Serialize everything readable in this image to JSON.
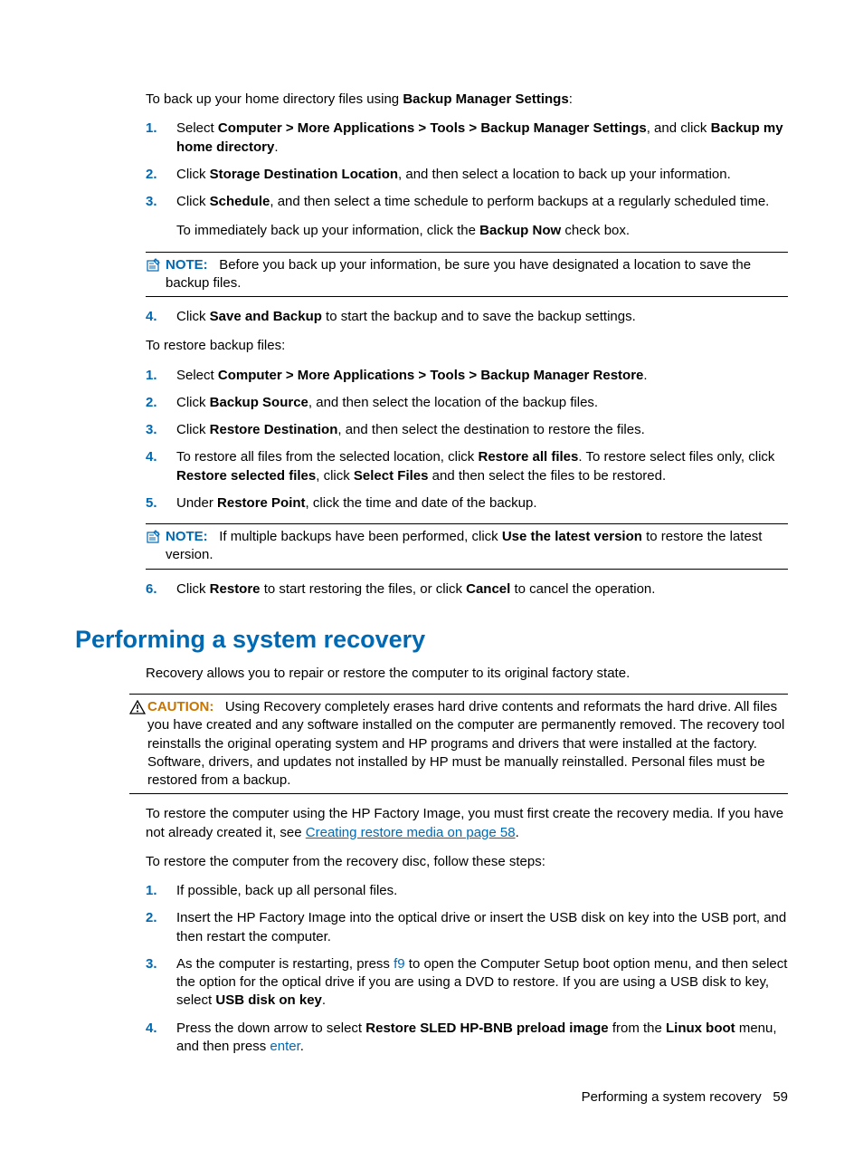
{
  "top": {
    "intro_parts": [
      "To back up your home directory files using ",
      "Backup Manager Settings",
      ":"
    ],
    "list1": [
      {
        "num": "1.",
        "parts": [
          "Select ",
          "Computer > More Applications > Tools > Backup Manager Settings",
          ", and click ",
          "Backup my home directory",
          "."
        ]
      },
      {
        "num": "2.",
        "parts": [
          "Click ",
          "Storage Destination Location",
          ", and then select a location to back up your information."
        ]
      },
      {
        "num": "3.",
        "parts": [
          "Click ",
          "Schedule",
          ", and then select a time schedule to perform backups at a regularly scheduled time."
        ],
        "sub": [
          "To immediately back up your information, click the ",
          "Backup Now",
          " check box."
        ]
      }
    ],
    "note1": {
      "label": "NOTE:",
      "text": "Before you back up your information, be sure you have designated a location to save the backup files."
    },
    "list1b": [
      {
        "num": "4.",
        "parts": [
          "Click ",
          "Save and Backup",
          " to start the backup and to save the backup settings."
        ]
      }
    ],
    "restore_intro": "To restore backup files:",
    "list2": [
      {
        "num": "1.",
        "parts": [
          "Select ",
          "Computer > More Applications > Tools > Backup Manager Restore",
          "."
        ]
      },
      {
        "num": "2.",
        "parts": [
          "Click ",
          "Backup Source",
          ", and then select the location of the backup files."
        ]
      },
      {
        "num": "3.",
        "parts": [
          "Click ",
          "Restore Destination",
          ", and then select the destination to restore the files."
        ]
      },
      {
        "num": "4.",
        "parts": [
          "To restore all files from the selected location, click ",
          "Restore all files",
          ". To restore select files only, click ",
          "Restore selected files",
          ", click ",
          "Select Files",
          " and then select the files to be restored."
        ]
      },
      {
        "num": "5.",
        "parts": [
          "Under ",
          "Restore Point",
          ", click the time and date of the backup."
        ]
      }
    ],
    "note2": {
      "label": "NOTE:",
      "pre": "If multiple backups have been performed, click ",
      "bold": "Use the latest version",
      "post": " to restore the latest version."
    },
    "list2b": [
      {
        "num": "6.",
        "parts": [
          "Click ",
          "Restore",
          " to start restoring the files, or click ",
          "Cancel",
          " to cancel the operation."
        ]
      }
    ]
  },
  "section": {
    "heading": "Performing a system recovery",
    "intro": "Recovery allows you to repair or restore the computer to its original factory state.",
    "caution": {
      "label": "CAUTION:",
      "text": "Using Recovery completely erases hard drive contents and reformats the hard drive. All files you have created and any software installed on the computer are permanently removed. The recovery tool reinstalls the original operating system and HP programs and drivers that were installed at the factory. Software, drivers, and updates not installed by HP must be manually reinstalled. Personal files must be restored from a backup."
    },
    "p1_pre": "To restore the computer using the HP Factory Image, you must first create the recovery media. If you have not already created it, see ",
    "p1_link": "Creating restore media on page 58",
    "p1_post": ".",
    "p2": "To restore the computer from the recovery disc, follow these steps:",
    "list": [
      {
        "num": "1.",
        "parts": [
          "If possible, back up all personal files."
        ]
      },
      {
        "num": "2.",
        "parts": [
          "Insert the HP Factory Image into the optical drive or insert the USB disk on key into the USB port, and then restart the computer."
        ]
      },
      {
        "num": "3.",
        "pre": "As the computer is restarting, press ",
        "key": "f9",
        "mid": " to open the Computer Setup boot option menu, and then select the option for the optical drive if you are using a DVD to restore. If you are using a USB disk to key, select ",
        "bold": "USB disk on key",
        "post": "."
      },
      {
        "num": "4.",
        "pre": "Press the down arrow to select ",
        "bold": "Restore SLED HP-BNB preload image",
        "mid": " from the ",
        "bold2": "Linux boot",
        "mid2": " menu, and then press ",
        "key": "enter",
        "post": "."
      }
    ]
  },
  "footer": {
    "title": "Performing a system recovery",
    "page": "59"
  }
}
